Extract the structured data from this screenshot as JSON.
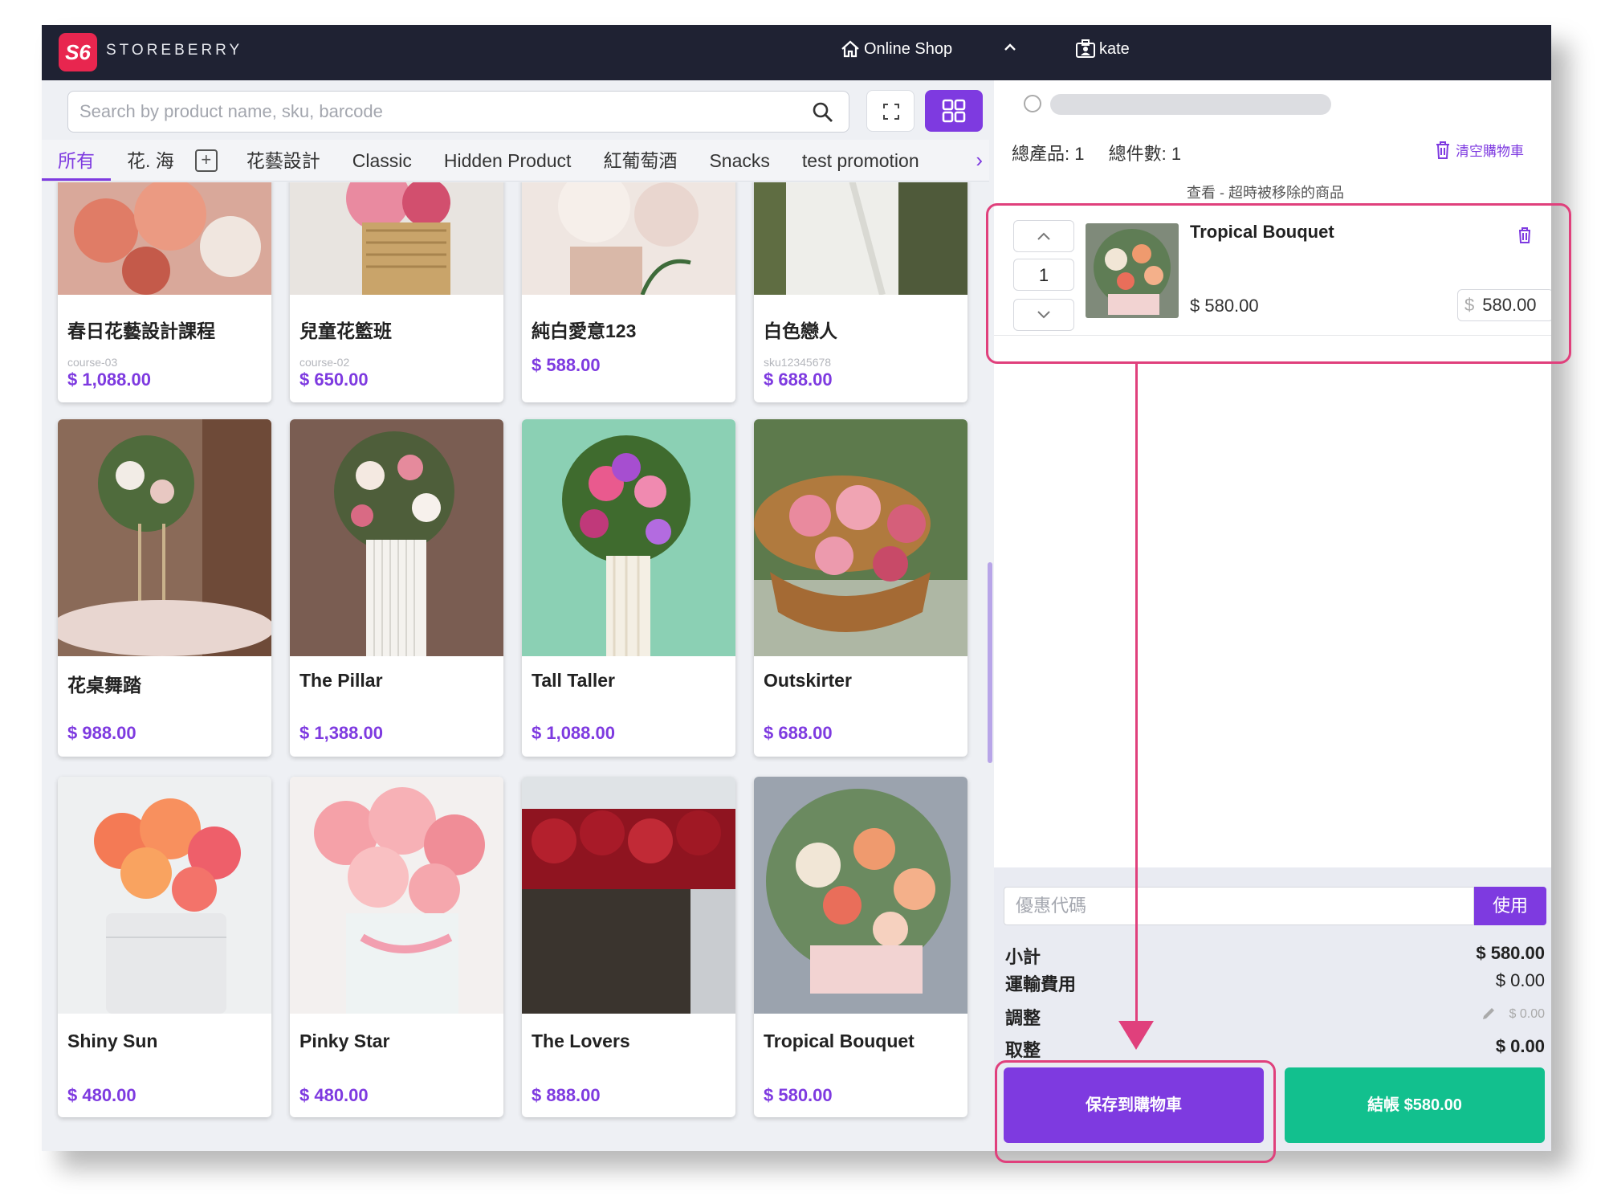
{
  "topbar": {
    "logo_text": "S6",
    "brand": "STOREBERRY",
    "online_shop": "Online Shop",
    "user": "kate"
  },
  "search": {
    "placeholder": "Search by product name, sku, barcode"
  },
  "tabs": [
    "所有",
    "花. 海",
    "花藝設計",
    "Classic",
    "Hidden Product",
    "紅葡萄酒",
    "Snacks",
    "test promotion"
  ],
  "products": [
    {
      "name": "春日花藝設計課程",
      "sku": "course-03",
      "price": "$ 1,088.00"
    },
    {
      "name": "兒童花籃班",
      "sku": "course-02",
      "price": "$ 650.00"
    },
    {
      "name": "純白愛意123",
      "sku": "",
      "price": "$ 588.00"
    },
    {
      "name": "白色戀人",
      "sku": "sku12345678",
      "price": "$ 688.00"
    },
    {
      "name": "花桌舞踏",
      "sku": "",
      "price": "$ 988.00"
    },
    {
      "name": "The Pillar",
      "sku": "",
      "price": "$ 1,388.00"
    },
    {
      "name": "Tall Taller",
      "sku": "",
      "price": "$ 1,088.00"
    },
    {
      "name": "Outskirter",
      "sku": "",
      "price": "$ 688.00"
    },
    {
      "name": "Shiny Sun",
      "sku": "",
      "price": "$ 480.00"
    },
    {
      "name": "Pinky Star",
      "sku": "",
      "price": "$ 480.00"
    },
    {
      "name": "The Lovers",
      "sku": "",
      "price": "$ 888.00"
    },
    {
      "name": "Tropical Bouquet",
      "sku": "",
      "price": "$ 580.00"
    }
  ],
  "cart": {
    "total_products": "總產品: 1",
    "total_items": "總件數: 1",
    "clear_cart": "清空購物車",
    "removed_link": "查看 - 超時被移除的商品",
    "line": {
      "name": "Tropical Bouquet",
      "quantity": "1",
      "unit_price": "$ 580.00",
      "currency": "$",
      "total": "580.00"
    },
    "coupon_placeholder": "優惠代碼",
    "coupon_button": "使用",
    "subtotal_label": "小計",
    "subtotal_value": "$ 580.00",
    "shipping_label": "運輸費用",
    "shipping_value": "$ 0.00",
    "adjust_label": "調整",
    "adjust_value": "$ 0.00",
    "rounding_label": "取整",
    "rounding_value": "$ 0.00",
    "save_button": "保存到購物車",
    "checkout_button": "結帳 $580.00"
  },
  "colors": {
    "accent": "#7e3ae0",
    "checkout": "#12c08e",
    "annotation": "#e0407c",
    "topbar": "#1f2233"
  }
}
